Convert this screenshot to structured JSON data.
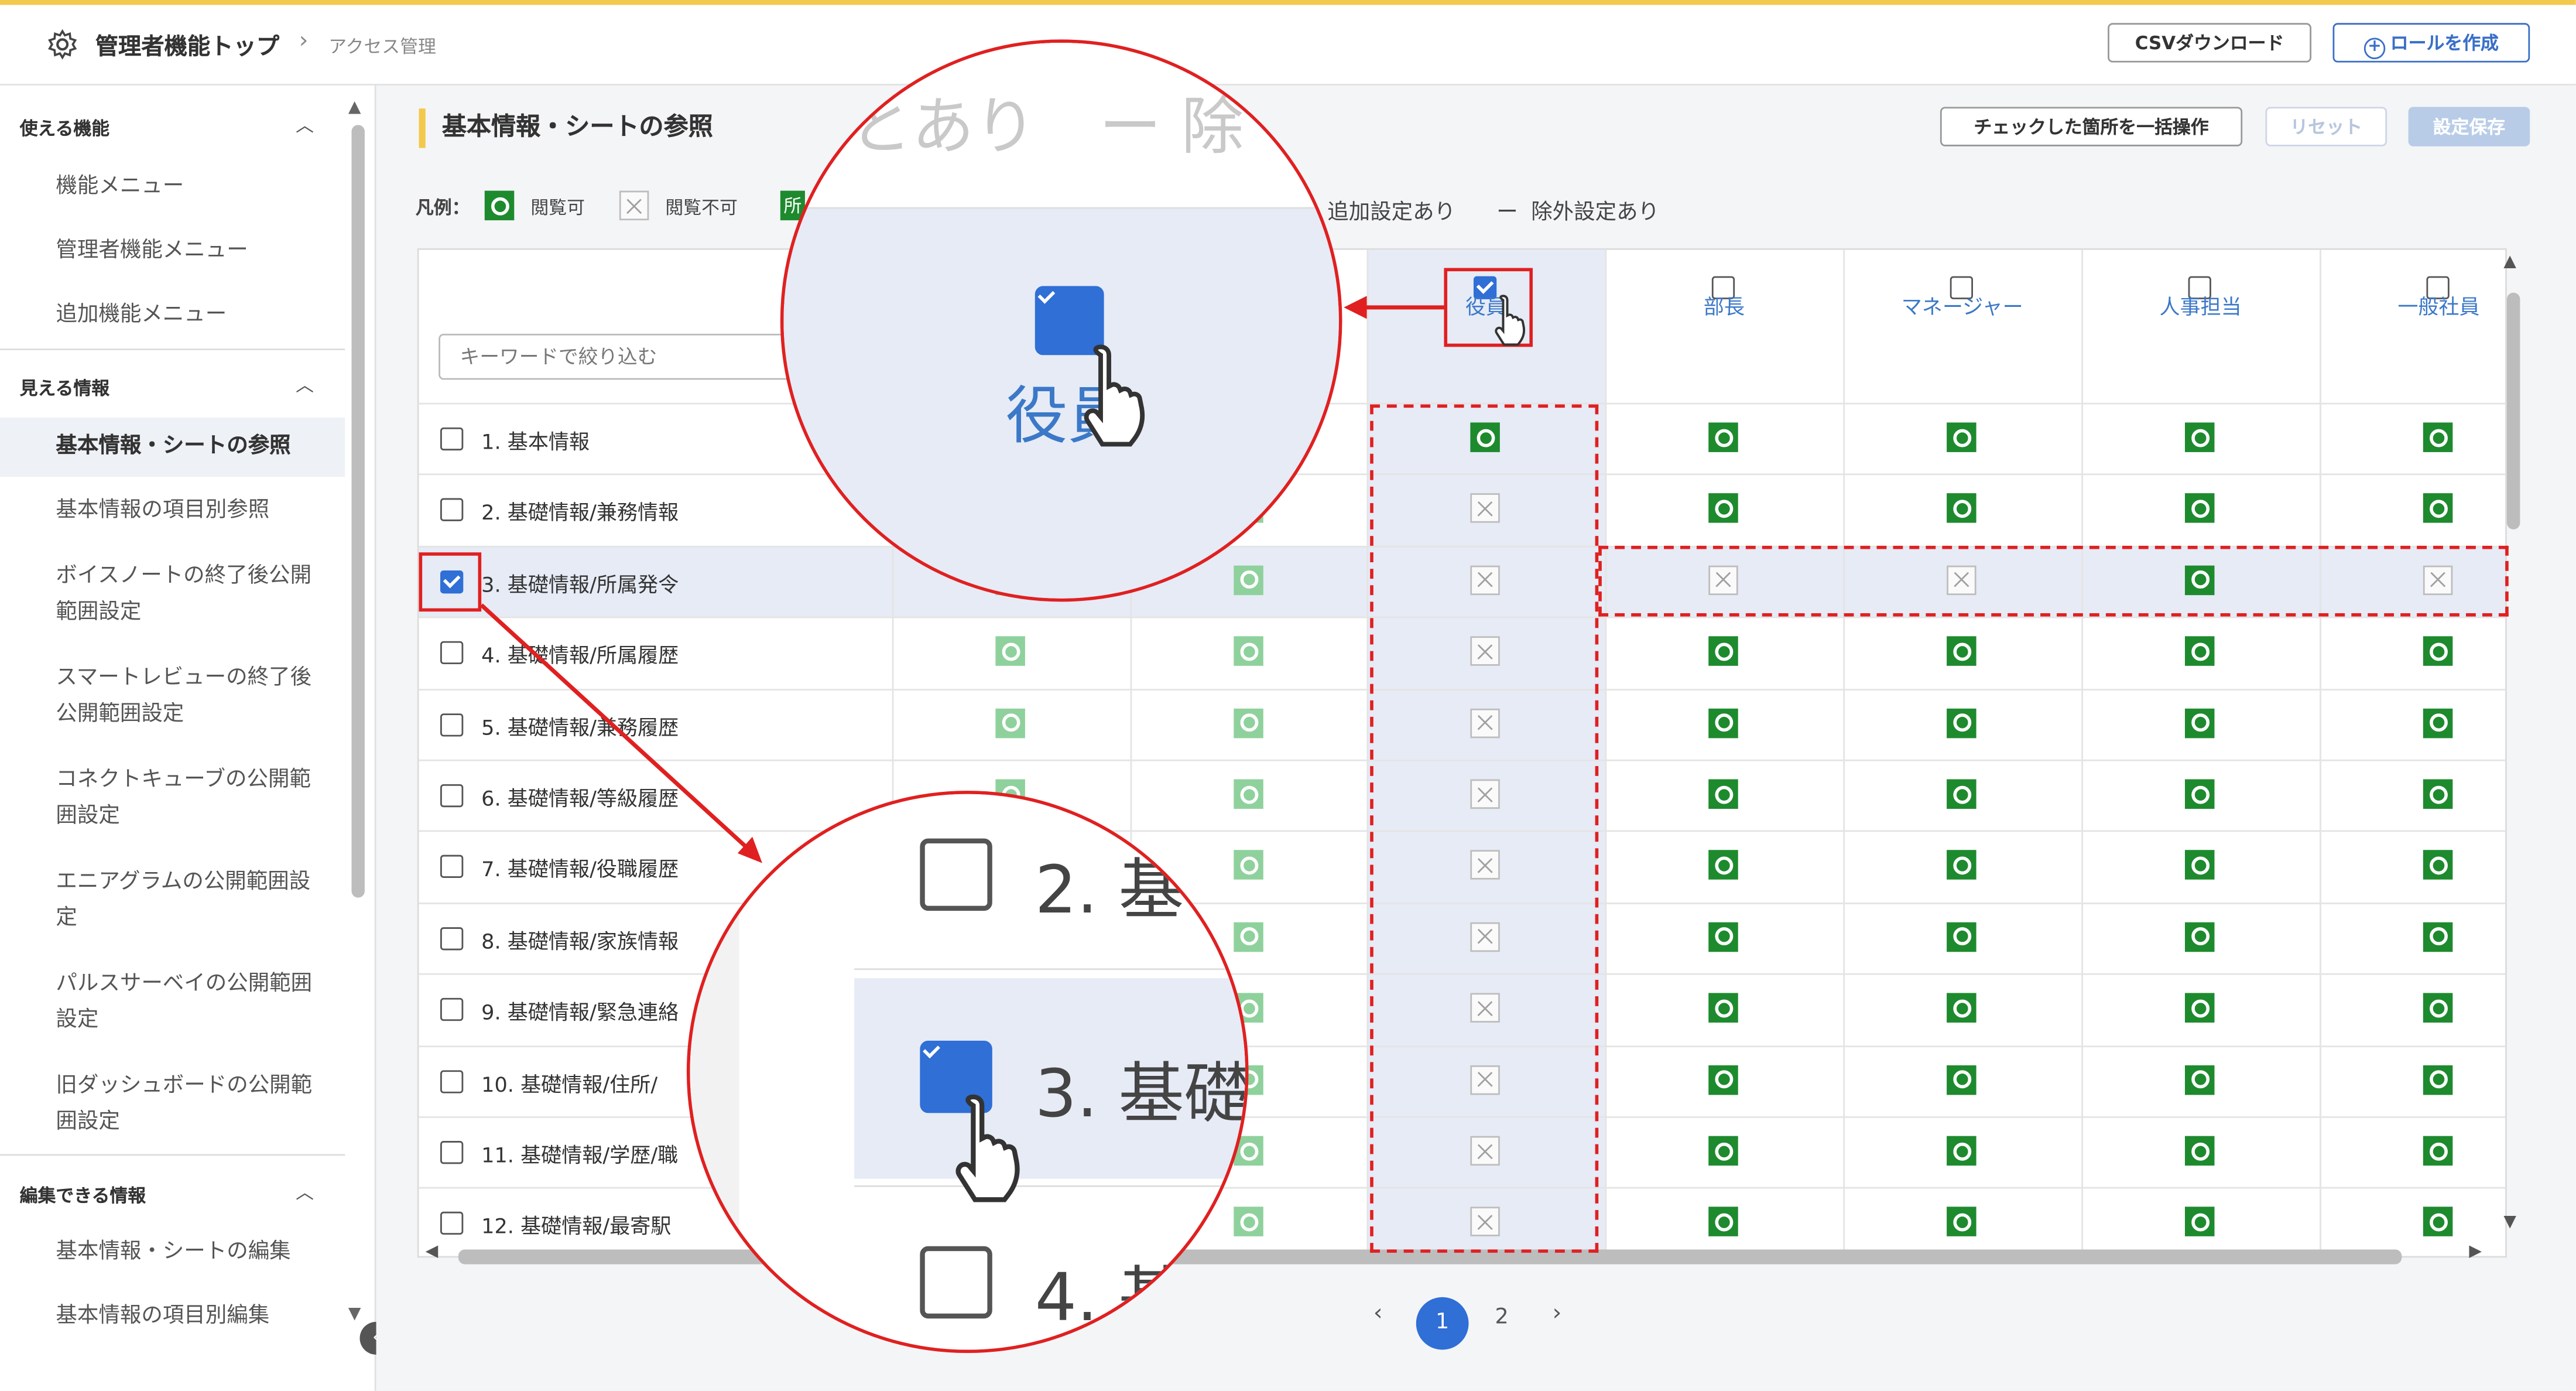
{
  "header": {
    "title": "管理者機能トップ",
    "breadcrumb_sub": "アクセス管理",
    "csv_button": "CSVダウンロード",
    "create_role_button": "ロールを作成"
  },
  "sidebar": {
    "sections": [
      {
        "title": "使える機能",
        "items": [
          "機能メニュー",
          "管理者機能メニュー",
          "追加機能メニュー"
        ]
      },
      {
        "title": "見える情報",
        "items": [
          "基本情報・シートの参照",
          "基本情報の項目別参照",
          "ボイスノートの終了後公開範囲設定",
          "スマートレビューの終了後公開範囲設定",
          "コネクトキューブの公開範囲設定",
          "エニアグラムの公開範囲設定",
          "パルスサーベイの公開範囲設定",
          "旧ダッシュボードの公開範囲設定"
        ]
      },
      {
        "title": "編集できる情報",
        "items": [
          "基本情報・シートの編集",
          "基本情報の項目別編集"
        ]
      }
    ]
  },
  "page": {
    "title": "基本情報・シートの参照",
    "bulk_button": "チェックした箇所を一括操作",
    "reset_button": "リセット",
    "save_button": "設定保存"
  },
  "legend": {
    "label": "凡例：",
    "viewable": "閲覧可",
    "not_viewable": "閲覧不可",
    "partial_prefix": "所",
    "added": "追加設定あり",
    "excluded": "除外設定あり"
  },
  "search": {
    "placeholder": "キーワードで絞り込む"
  },
  "roles": [
    "役員",
    "部長",
    "マネージャー",
    "人事担当",
    "一般社員"
  ],
  "rows": [
    {
      "label": "1. 基本情報",
      "checked": false,
      "cells": [
        "ok",
        "ok",
        "ok",
        "ok",
        "ok"
      ]
    },
    {
      "label": "2. 基礎情報/兼務情報",
      "checked": false,
      "cells": [
        "ng",
        "ok",
        "ok",
        "ok",
        "ok"
      ]
    },
    {
      "label": "3. 基礎情報/所属発令",
      "checked": true,
      "cells": [
        "ng",
        "ng",
        "ng",
        "ok",
        "ng"
      ]
    },
    {
      "label": "4. 基礎情報/所属履歴",
      "checked": false,
      "cells": [
        "ng",
        "ok",
        "ok",
        "ok",
        "ok"
      ]
    },
    {
      "label": "5. 基礎情報/兼務履歴",
      "checked": false,
      "cells": [
        "ng",
        "ok",
        "ok",
        "ok",
        "ok"
      ]
    },
    {
      "label": "6. 基礎情報/等級履歴",
      "checked": false,
      "cells": [
        "ng",
        "ok",
        "ok",
        "ok",
        "ok"
      ]
    },
    {
      "label": "7. 基礎情報/役職履歴",
      "checked": false,
      "cells": [
        "ng",
        "ok",
        "ok",
        "ok",
        "ok"
      ]
    },
    {
      "label": "8. 基礎情報/家族情報",
      "checked": false,
      "cells": [
        "ng",
        "ok",
        "ok",
        "ok",
        "ok"
      ]
    },
    {
      "label": "9. 基礎情報/緊急連絡",
      "checked": false,
      "cells": [
        "ng",
        "ok",
        "ok",
        "ok",
        "ok"
      ]
    },
    {
      "label": "10. 基礎情報/住所/",
      "checked": false,
      "cells": [
        "ng",
        "ok",
        "ok",
        "ok",
        "ok"
      ]
    },
    {
      "label": "11. 基礎情報/学歴/職",
      "checked": false,
      "cells": [
        "ng",
        "ok",
        "ok",
        "ok",
        "ok"
      ]
    },
    {
      "label": "12. 基礎情報/最寄駅",
      "checked": false,
      "cells": [
        "ng",
        "ok",
        "ok",
        "ok",
        "ok"
      ]
    }
  ],
  "pagination": {
    "pages": [
      "1",
      "2"
    ],
    "current": "1"
  },
  "zoom_top": {
    "text_top": "とあり　ー 除",
    "role": "役員"
  },
  "zoom_bottom": {
    "rows": [
      "2. 基",
      "3. 基礎",
      "4. 基"
    ]
  }
}
